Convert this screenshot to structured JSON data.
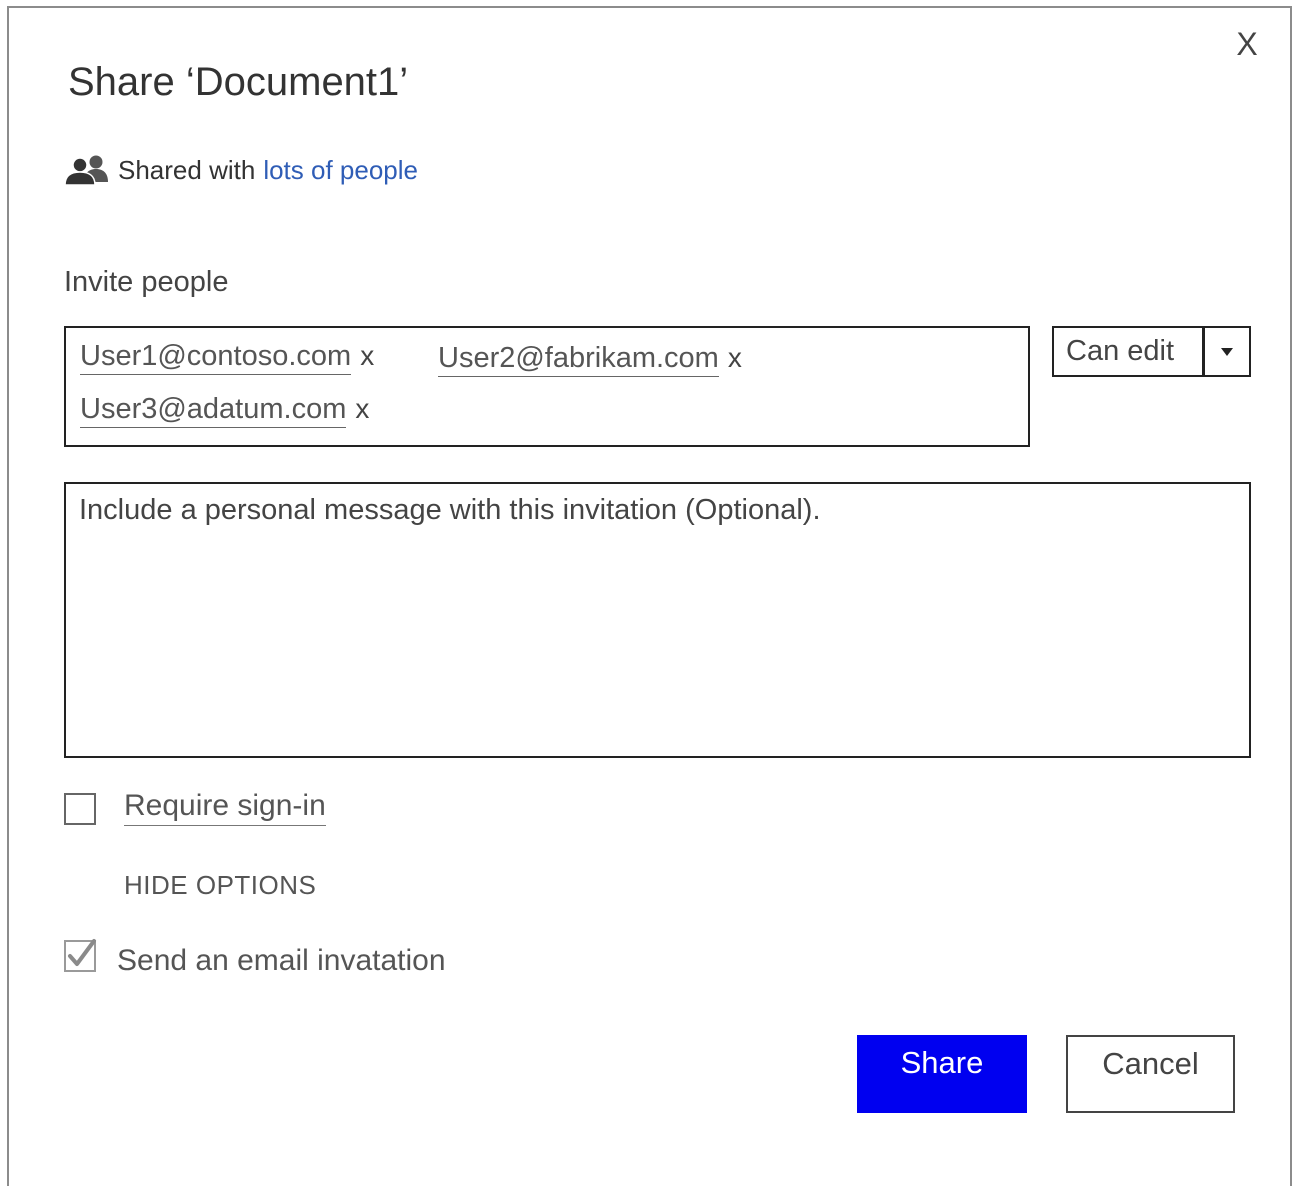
{
  "dialog": {
    "title": "Share ‘Document1’",
    "close_label": "X"
  },
  "shared": {
    "icon": "people-icon",
    "prefix": "Shared with",
    "link_text": "lots of people"
  },
  "invite": {
    "label": "Invite people",
    "recipients": [
      {
        "email": "User1@contoso.com",
        "remove": "x"
      },
      {
        "email": "User2@fabrikam.com",
        "remove": "x"
      },
      {
        "email": "User3@adatum.com",
        "remove": "x"
      }
    ],
    "permission": {
      "selected": "Can edit",
      "arrow_icon": "caret-down-icon"
    }
  },
  "message": {
    "placeholder": "Include a personal message with this invitation (Optional)."
  },
  "options": {
    "require_signin": {
      "label": "Require sign-in",
      "checked": false
    },
    "toggle_label": "HIDE OPTIONS",
    "send_email": {
      "label": "Send an email invatation",
      "checked": true
    }
  },
  "buttons": {
    "share": "Share",
    "cancel": "Cancel"
  },
  "colors": {
    "link": "#2f5db6",
    "primary_button": "#0000f0",
    "border": "#222222"
  }
}
